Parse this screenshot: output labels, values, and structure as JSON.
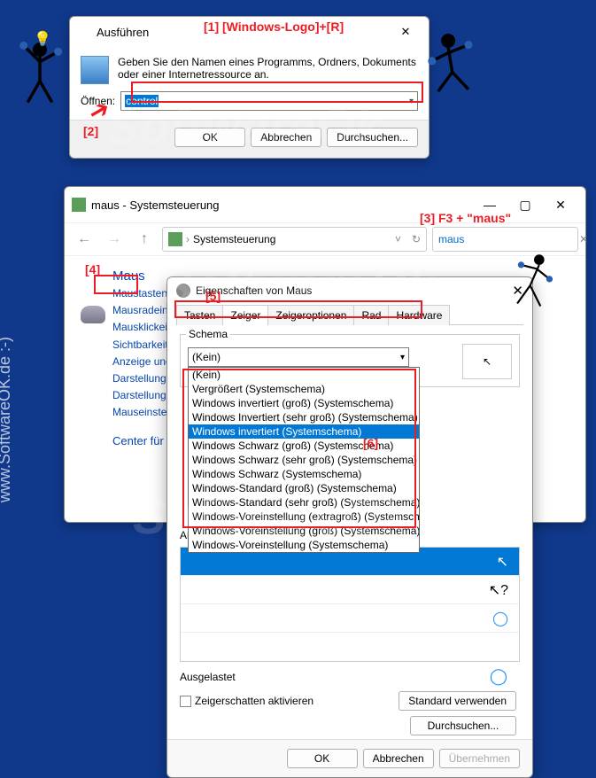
{
  "run": {
    "title": "Ausführen",
    "instruction": "Geben Sie den Namen eines Programms, Ordners, Dokuments oder einer Internetressource an.",
    "open_label": "Öffnen:",
    "input_value": "control",
    "ok": "OK",
    "cancel": "Abbrechen",
    "browse": "Durchsuchen..."
  },
  "cp": {
    "title": "maus - Systemsteuerung",
    "breadcrumb": "Systemsteuerung",
    "search_value": "maus",
    "heading": "Maus",
    "links": [
      "Maustasten anpassen",
      "Mausradeinstellungen",
      "Mausklickeinstellungen",
      "Sichtbarkeit des Mauszeigers",
      "Anzeige und Geschwindigkeit",
      "Darstellung des Mauszeigers",
      "Darstellung des Mauszeigers",
      "Mauseinstellungen ändern"
    ],
    "ease": "Center für erleichterte Bedienung"
  },
  "mp": {
    "title": "Eigenschaften von Maus",
    "tabs": [
      "Tasten",
      "Zeiger",
      "Zeigeroptionen",
      "Rad",
      "Hardware"
    ],
    "schema_label": "Schema",
    "schema_selected": "(Kein)",
    "schema_options": [
      "(Kein)",
      "Vergrößert (Systemschema)",
      "Windows invertiert (groß) (Systemschema)",
      "Windows Invertiert (sehr groß) (Systemschema)",
      "Windows invertiert (Systemschema)",
      "Windows Schwarz (groß) (Systemschema)",
      "Windows Schwarz (sehr groß) (Systemschema)",
      "Windows Schwarz (Systemschema)",
      "Windows-Standard (groß) (Systemschema)",
      "Windows-Standard (sehr groß) (Systemschema)",
      "Windows-Voreinstellung (extragroß) (Systemschema)",
      "Windows-Voreinstellung (groß) (Systemschema)",
      "Windows-Voreinstellung (Systemschema)"
    ],
    "anpassen": "Anpassen",
    "ausgelastet": "Ausgelastet",
    "shadow": "Zeigerschatten aktivieren",
    "std": "Standard verwenden",
    "browse": "Durchsuchen...",
    "ok": "OK",
    "cancel": "Abbrechen",
    "apply": "Übernehmen"
  },
  "annotations": {
    "a1": "[1]   [Windows-Logo]+[R]",
    "a2": "[2]",
    "a3": "[3]  F3 + \"maus\"",
    "a4": "[4]",
    "a5": "[5]",
    "a6": "[6]"
  },
  "watermark": {
    "text": "SoftwareOk",
    "site": "www.SoftwareOK.de  :-)",
    "side": "www.SoftwareOK.de :-)"
  }
}
